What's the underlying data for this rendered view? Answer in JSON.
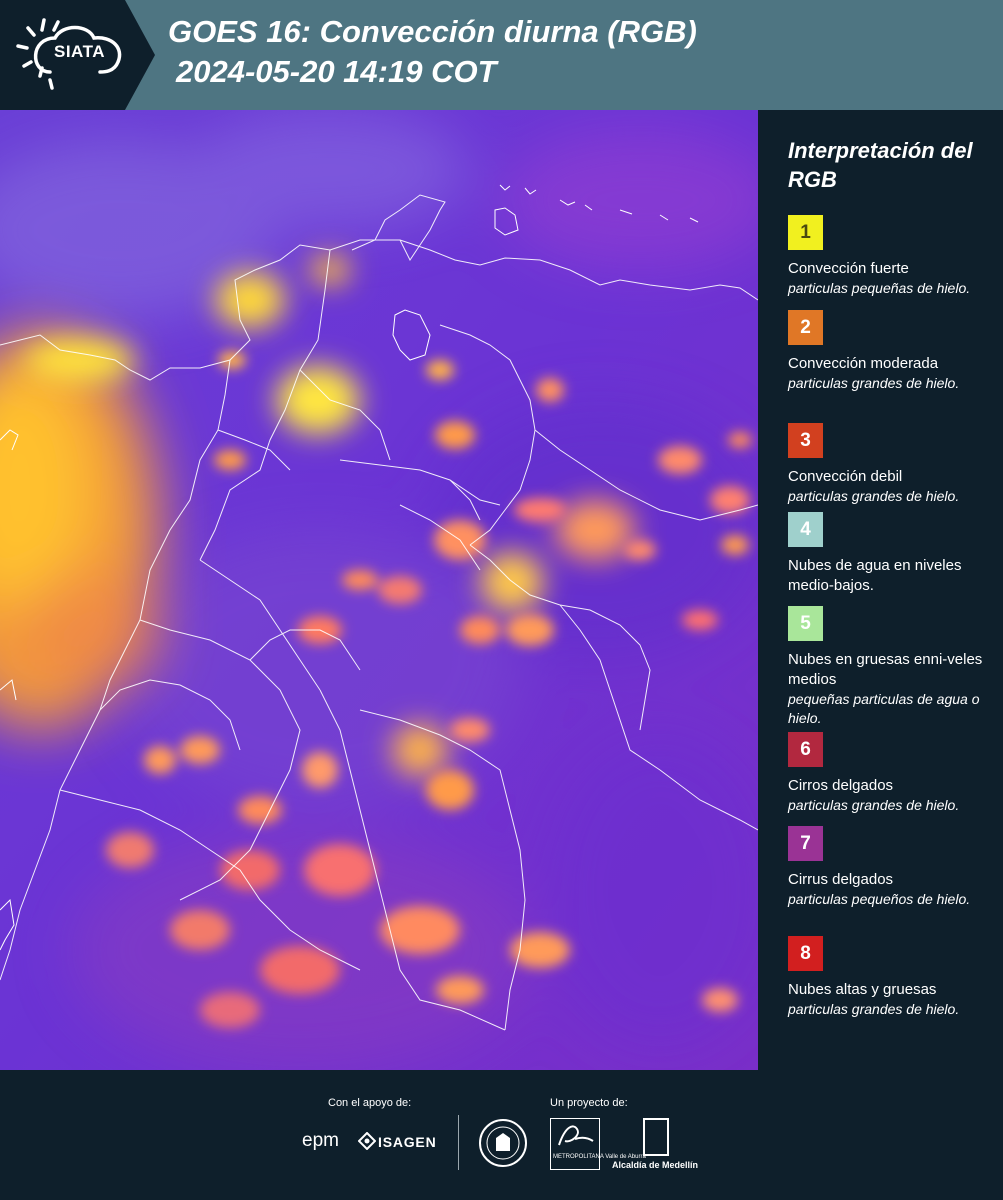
{
  "header": {
    "logo_text": "SIATA",
    "title_line1": "GOES 16: Convección diurna (RGB)",
    "title_line2": "2024-05-20 14:19 COT"
  },
  "legend": {
    "title": "Interpretación del RGB",
    "items": [
      {
        "number": "1",
        "color": "#f1f01f",
        "text_color": "#4a4a10",
        "label": "Convección fuerte",
        "sub": "particulas pequeñas de hielo."
      },
      {
        "number": "2",
        "color": "#e07726",
        "text_color": "#ffffff",
        "label": "Convección moderada",
        "sub": "particulas grandes de hielo."
      },
      {
        "number": "3",
        "color": "#d2401f",
        "text_color": "#ffffff",
        "label": "Convección debil",
        "sub": "particulas grandes de hielo."
      },
      {
        "number": "4",
        "color": "#9fd0cc",
        "text_color": "#ffffff",
        "label": "Nubes de agua en niveles medio-bajos.",
        "sub": ""
      },
      {
        "number": "5",
        "color": "#a9e69a",
        "text_color": "#ffffff",
        "label": "Nubes en gruesas enni-veles medios",
        "sub": "pequeñas particulas de agua o hielo."
      },
      {
        "number": "6",
        "color": "#b2283f",
        "text_color": "#ffffff",
        "label": "Cirros delgados",
        "sub": "particulas grandes de hielo."
      },
      {
        "number": "7",
        "color": "#9a3395",
        "text_color": "#ffffff",
        "label": "Cirrus delgados",
        "sub": "particulas pequeños de hielo."
      },
      {
        "number": "8",
        "color": "#d21f1f",
        "text_color": "#ffffff",
        "label": "Nubes altas y gruesas",
        "sub": "particulas grandes de hielo."
      }
    ]
  },
  "footer": {
    "support_label": "Con el apoyo de:",
    "project_label": "Un proyecto de:",
    "sponsors": [
      "epm",
      "ISAGEN"
    ],
    "partners": [
      "Área Metropolitana Valle de Aburrá",
      "Alcaldía de Medellín"
    ],
    "area_text": "METROPOLITANA Valle de Aburrá",
    "alcaldia_text": "Alcaldía de Medellín"
  }
}
